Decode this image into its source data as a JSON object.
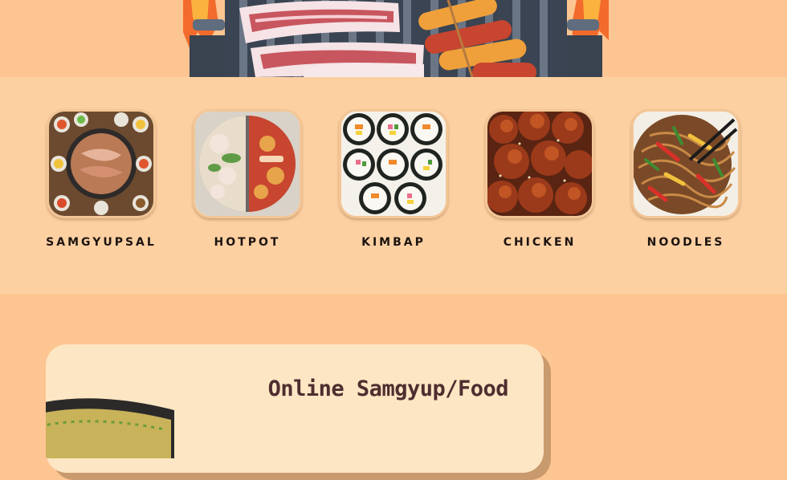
{
  "categories": [
    {
      "label": "SAMGYUPSAL",
      "image": "samgyupsal-photo"
    },
    {
      "label": "HOTPOT",
      "image": "hotpot-photo"
    },
    {
      "label": "KIMBAP",
      "image": "kimbap-photo"
    },
    {
      "label": "CHICKEN",
      "image": "chicken-photo"
    },
    {
      "label": "NOODLES",
      "image": "noodles-photo"
    }
  ],
  "card": {
    "title": "Online Samgyup/Food"
  },
  "colors": {
    "page_bg": "#fdc592",
    "band_bg": "#fdd0a2",
    "card_bg": "#fde6c3",
    "title_text": "#4e2d2f",
    "label_text": "#1c1410"
  }
}
